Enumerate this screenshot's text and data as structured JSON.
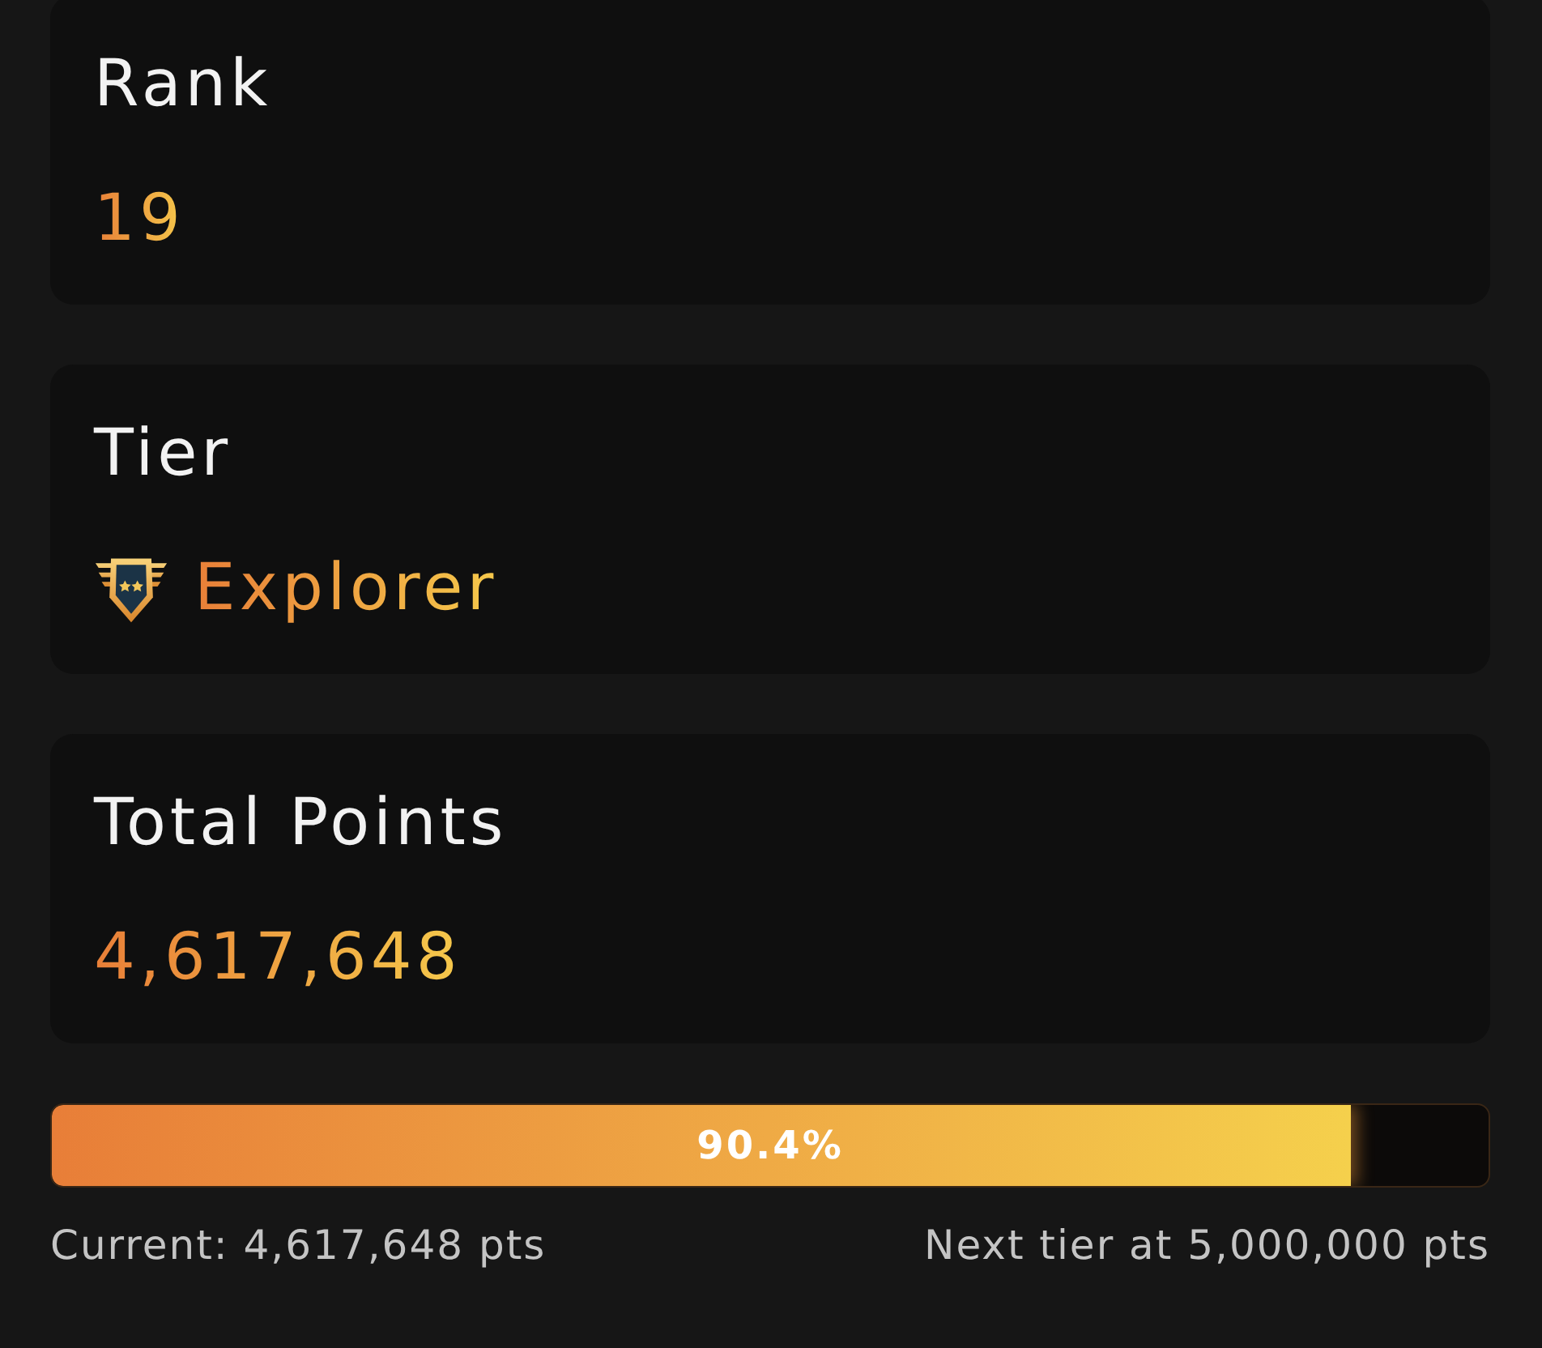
{
  "cards": [
    {
      "kind": "plain",
      "title": "Rank",
      "value": "19"
    },
    {
      "kind": "badge",
      "title": "Tier",
      "value": "Explorer"
    },
    {
      "kind": "plain",
      "title": "Total Points",
      "value": "4,617,648"
    }
  ],
  "progress": {
    "level": 0.904,
    "label": "90.4%",
    "current": "Current: 4,617,648 pts",
    "next": "Next tier at 5,000,000 pts"
  }
}
